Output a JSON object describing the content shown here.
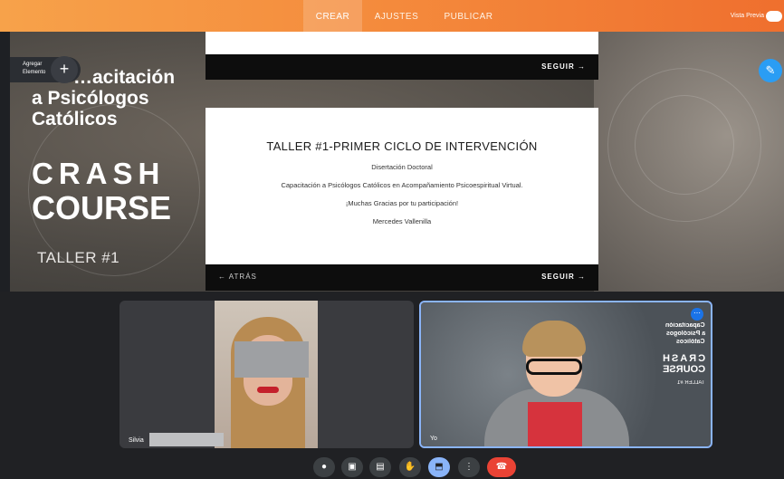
{
  "topbar": {
    "tabs": [
      {
        "label": "CREAR",
        "active": true
      },
      {
        "label": "AJUSTES",
        "active": false
      },
      {
        "label": "PUBLICAR",
        "active": false
      }
    ],
    "preview_label": "Vista Previa",
    "accent": "#f48a3c"
  },
  "editor": {
    "add_element_label": "Agregar Elemento",
    "add_icon": "plus-icon",
    "blue_icon": "pen-icon"
  },
  "course": {
    "title_line1": "…acitación",
    "title_line2": "a Psicólogos",
    "title_line3": "Católicos",
    "crash": "CRASH",
    "course": "COURSE",
    "taller": "TALLER #1"
  },
  "slide_top": {
    "next_label": "SEGUIR →"
  },
  "slide_main": {
    "title": "TALLER #1-PRIMER CICLO DE INTERVENCIÓN",
    "line1": "Disertación Doctoral",
    "line2": "Capacitación a Psicólogos Católicos en Acompañamiento Psicoespiritual Virtual.",
    "line3": "¡Muchas Gracias por tu participación!",
    "line4": "Mercedes Vallenilla",
    "back_label": "← ATRÁS",
    "next_label": "SEGUIR →"
  },
  "meeting": {
    "participants": [
      {
        "name": "Silvia"
      },
      {
        "name": "Yo"
      }
    ],
    "shared_mirror": {
      "l1": "Capacitación",
      "l2": "a Psicólogos",
      "l3": "Católicos",
      "l4": "CRASH",
      "l5": "COURSE",
      "l6": "TALLER #1"
    },
    "controls": [
      {
        "icon": "microphone-icon",
        "glyph": "🎤"
      },
      {
        "icon": "camera-icon",
        "glyph": "▣"
      },
      {
        "icon": "captions-icon",
        "glyph": "▤"
      },
      {
        "icon": "hand-icon",
        "glyph": "✋"
      },
      {
        "icon": "present-icon",
        "glyph": "⬒"
      },
      {
        "icon": "more-icon",
        "glyph": "⋮"
      },
      {
        "icon": "end-call-icon",
        "glyph": "☎"
      }
    ]
  }
}
